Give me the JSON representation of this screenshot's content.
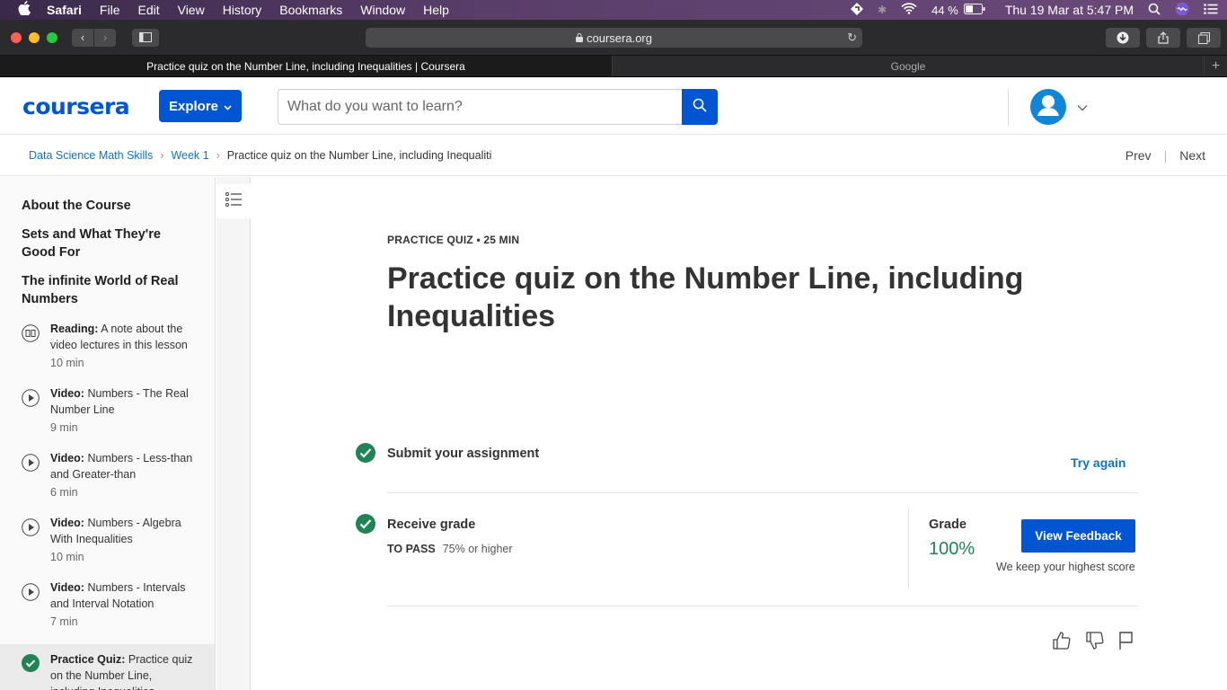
{
  "menubar": {
    "app": "Safari",
    "items": [
      "File",
      "Edit",
      "View",
      "History",
      "Bookmarks",
      "Window",
      "Help"
    ],
    "battery": "44 %",
    "datetime": "Thu 19 Mar at  5:47 PM"
  },
  "browser": {
    "url": "coursera.org",
    "tabs": [
      {
        "title": "Practice quiz on the Number Line, including Inequalities | Coursera"
      },
      {
        "title": "Google"
      }
    ]
  },
  "header": {
    "logo": "coursera",
    "explore": "Explore",
    "search_placeholder": "What do you want to learn?"
  },
  "breadcrumb": {
    "course": "Data Science Math Skills",
    "week": "Week 1",
    "current": "Practice quiz on the Number Line, including Inequaliti",
    "prev": "Prev",
    "next": "Next"
  },
  "sidebar": {
    "sections": [
      "About the Course",
      "Sets and What They're Good For",
      "The infinite World of Real Numbers"
    ],
    "items": [
      {
        "type": "Reading:",
        "title": "A note about the video lectures in this lesson",
        "duration": "10 min",
        "icon": "book-icon"
      },
      {
        "type": "Video:",
        "title": "Numbers - The Real Number Line",
        "duration": "9 min",
        "icon": "play-icon"
      },
      {
        "type": "Video:",
        "title": "Numbers - Less-than and Greater-than",
        "duration": "6 min",
        "icon": "play-icon"
      },
      {
        "type": "Video:",
        "title": "Numbers - Algebra With Inequalities",
        "duration": "10 min",
        "icon": "play-icon"
      },
      {
        "type": "Video:",
        "title": "Numbers - Intervals and Interval Notation",
        "duration": "7 min",
        "icon": "play-icon"
      },
      {
        "type": "Practice Quiz:",
        "title": "Practice quiz on the Number Line, including Inequalities",
        "duration": "",
        "icon": "check-icon"
      }
    ]
  },
  "main": {
    "kicker": "PRACTICE QUIZ • 25 MIN",
    "title": "Practice quiz on the Number Line, including Inequalities",
    "submit_label": "Submit your assignment",
    "try_again": "Try again",
    "receive_grade": "Receive grade",
    "to_pass_label": "TO PASS",
    "to_pass_value": "75% or higher",
    "grade_label": "Grade",
    "grade_value": "100%",
    "view_feedback": "View Feedback",
    "keep_note": "We keep your highest score"
  },
  "colors": {
    "brand": "#0056d2",
    "success": "#1f8354",
    "link": "#0f73c8"
  }
}
